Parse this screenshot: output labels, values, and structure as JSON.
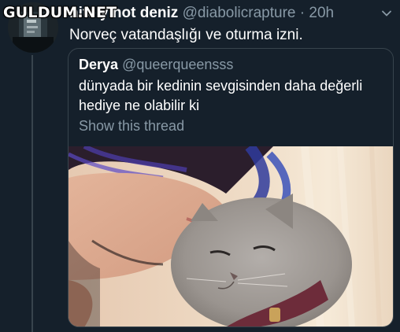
{
  "watermark": "GULDUM.NET",
  "tweet": {
    "display_name": "definitely not deniz",
    "display_name_visible": "nitely not deniz",
    "handle": "@diabolicrapture",
    "separator": "·",
    "time": "20h",
    "text": "Norveç vatandaşlığı ve oturma izni.",
    "menu_icon": "chevron-down-icon"
  },
  "quoted": {
    "display_name": "Derya",
    "handle": "@queerqueensss",
    "text": "dünyada bir kedinin sevgisinden daha değerli hediye ne olabilir ki",
    "show_thread": "Show this thread",
    "image": "photo of a woman kissing a grey cat"
  },
  "colors": {
    "background": "#15202b",
    "secondary_text": "#8899a6",
    "border": "#38444d"
  }
}
